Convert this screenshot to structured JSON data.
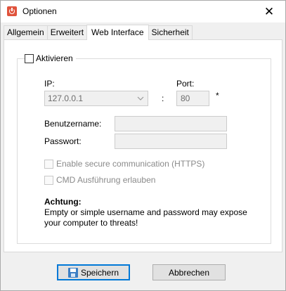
{
  "window": {
    "title": "Optionen",
    "icon": "app-power-icon",
    "close_glyph": "✕"
  },
  "tabs": [
    {
      "label": "Allgemein",
      "active": false
    },
    {
      "label": "Erweitert",
      "active": false
    },
    {
      "label": "Web Interface",
      "active": true
    },
    {
      "label": "Sicherheit",
      "active": false
    }
  ],
  "group": {
    "enable_label": "Aktivieren",
    "enable_checked": false,
    "ip_label": "IP:",
    "ip_value": "127.0.0.1",
    "colon": ":",
    "port_label": "Port:",
    "port_value": "80",
    "port_required_mark": "*",
    "username_label": "Benutzername:",
    "username_value": "",
    "password_label": "Passwort:",
    "password_value": "",
    "https_label": "Enable secure communication (HTTPS)",
    "https_checked": false,
    "cmd_label": "CMD Ausführung erlauben",
    "cmd_checked": false,
    "warning_title": "Achtung:",
    "warning_text": "Empty or simple username and password may expose your computer to threats!"
  },
  "buttons": {
    "save_label": "Speichern",
    "cancel_label": "Abbrechen"
  },
  "colors": {
    "accent": "#0078d7",
    "app_icon": "#e0533c",
    "disabled_text": "#6d6d6d"
  }
}
